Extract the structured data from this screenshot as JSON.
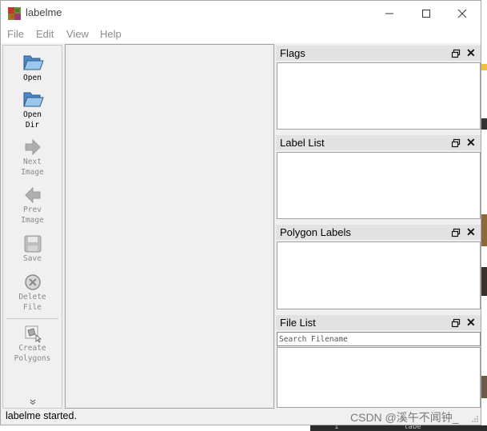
{
  "window": {
    "title": "labelme",
    "icon": "labelme-app-icon",
    "controls": [
      "minimize-icon",
      "maximize-icon",
      "close-icon"
    ]
  },
  "menu": {
    "items": [
      "File",
      "Edit",
      "View",
      "Help"
    ],
    "color": "#8c8c8c"
  },
  "toolbar": {
    "tools": [
      {
        "label": "Open",
        "icon": "folder-open-icon",
        "enabled": true
      },
      {
        "label": "Open\nDir",
        "icon": "folder-open-icon",
        "enabled": true
      },
      {
        "label": "Next\nImage",
        "icon": "arrow-right-icon",
        "enabled": false
      },
      {
        "label": "Prev\nImage",
        "icon": "arrow-left-icon",
        "enabled": false
      },
      {
        "label": "Save",
        "icon": "floppy-disk-icon",
        "enabled": false
      },
      {
        "label": "Delete\nFile",
        "icon": "delete-circle-icon",
        "enabled": false
      },
      {
        "label": "Create\nPolygons",
        "icon": "create-polygon-icon",
        "enabled": false
      }
    ],
    "overflow_icon": "chevron-double-down-icon"
  },
  "docks": {
    "flags": {
      "title": "Flags"
    },
    "label_list": {
      "title": "Label List"
    },
    "polygon_labels": {
      "title": "Polygon Labels"
    },
    "file_list": {
      "title": "File List",
      "search_placeholder": "Search Filename"
    }
  },
  "status": {
    "text": "labelme started."
  },
  "background": {
    "watermark": "CSDN @溪午不闻钟_",
    "code_fragments": [
      "1",
      "labe"
    ]
  },
  "colors": {
    "window_bg": "#f0f0f0",
    "dock_title_bg": "#e2e2e2",
    "disabled_text": "#8a8a8a"
  }
}
